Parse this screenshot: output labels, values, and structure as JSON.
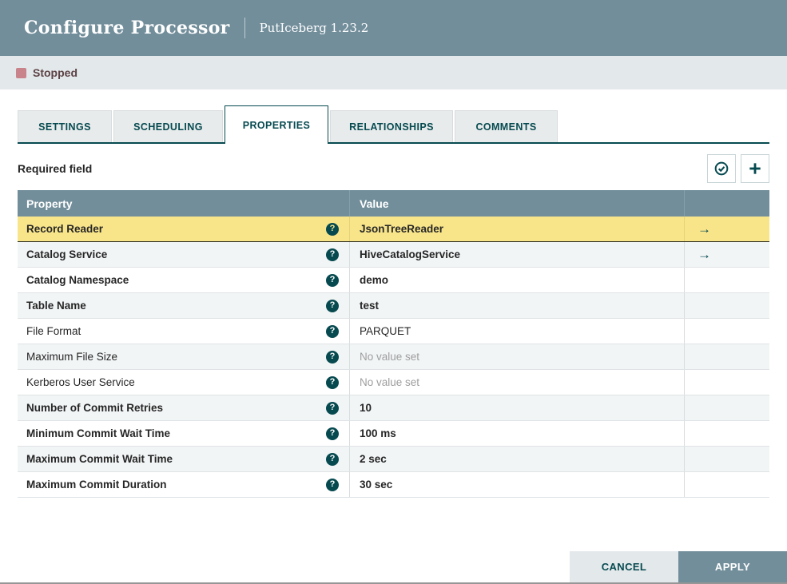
{
  "header": {
    "title": "Configure Processor",
    "subtitle": "PutIceberg 1.23.2"
  },
  "status": {
    "label": "Stopped",
    "icon": "stopped-square-icon",
    "color": "#c9838b"
  },
  "tabs": [
    {
      "label": "SETTINGS",
      "active": false
    },
    {
      "label": "SCHEDULING",
      "active": false
    },
    {
      "label": "PROPERTIES",
      "active": true
    },
    {
      "label": "RELATIONSHIPS",
      "active": false
    },
    {
      "label": "COMMENTS",
      "active": false
    }
  ],
  "properties_panel": {
    "required_field_label": "Required field",
    "toolbar": [
      {
        "icon": "verify-properties-icon"
      },
      {
        "icon": "add-property-icon"
      }
    ],
    "table": {
      "columns": [
        "Property",
        "Value"
      ],
      "rows": [
        {
          "property": "Record Reader",
          "value": "JsonTreeReader",
          "required": true,
          "selected": true,
          "no_value": false,
          "goto": true
        },
        {
          "property": "Catalog Service",
          "value": "HiveCatalogService",
          "required": true,
          "selected": false,
          "no_value": false,
          "goto": true
        },
        {
          "property": "Catalog Namespace",
          "value": "demo",
          "required": true,
          "selected": false,
          "no_value": false,
          "goto": false
        },
        {
          "property": "Table Name",
          "value": "test",
          "required": true,
          "selected": false,
          "no_value": false,
          "goto": false
        },
        {
          "property": "File Format",
          "value": "PARQUET",
          "required": false,
          "selected": false,
          "no_value": false,
          "goto": false
        },
        {
          "property": "Maximum File Size",
          "value": "No value set",
          "required": false,
          "selected": false,
          "no_value": true,
          "goto": false
        },
        {
          "property": "Kerberos User Service",
          "value": "No value set",
          "required": false,
          "selected": false,
          "no_value": true,
          "goto": false
        },
        {
          "property": "Number of Commit Retries",
          "value": "10",
          "required": true,
          "selected": false,
          "no_value": false,
          "goto": false
        },
        {
          "property": "Minimum Commit Wait Time",
          "value": "100 ms",
          "required": true,
          "selected": false,
          "no_value": false,
          "goto": false
        },
        {
          "property": "Maximum Commit Wait Time",
          "value": "2 sec",
          "required": true,
          "selected": false,
          "no_value": false,
          "goto": false
        },
        {
          "property": "Maximum Commit Duration",
          "value": "30 sec",
          "required": true,
          "selected": false,
          "no_value": false,
          "goto": false
        }
      ]
    }
  },
  "footer": {
    "cancel_label": "CANCEL",
    "apply_label": "APPLY"
  },
  "colors": {
    "header_bg": "#728e9b",
    "accent_teal": "#064a50",
    "selected_row_yellow": "#f8e58a",
    "alt_row": "#f2f5f6",
    "status_bar_bg": "#e3e8ea",
    "stopped_red": "#c9838b",
    "no_value_grey": "#9e9e9e"
  }
}
